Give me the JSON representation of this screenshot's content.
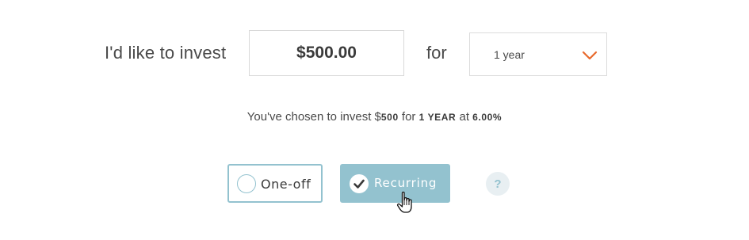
{
  "form": {
    "intro_label": "I'd like to invest",
    "amount_value": "$500.00",
    "for_label": "for",
    "period_selected": "1 year"
  },
  "summary": {
    "prefix": "You've chosen to invest $",
    "amount": "500",
    "for_text": " for ",
    "period": "1 YEAR",
    "at_text": " at ",
    "rate": "6.00%"
  },
  "options": {
    "one_off_label": "One-off",
    "recurring_label": "Recurring",
    "selected": "Recurring"
  },
  "help": {
    "label": "?"
  },
  "icons": {
    "dropdown": "chevron-down-icon",
    "unselected_option": "radio-empty-icon",
    "selected_option": "checkmark-icon",
    "pointer": "hand-pointer-cursor-icon"
  },
  "colors": {
    "accent": "#93c2cf",
    "chevron": "#e8692b",
    "text": "#4a4a4a",
    "help_bg": "#e8eff2"
  }
}
